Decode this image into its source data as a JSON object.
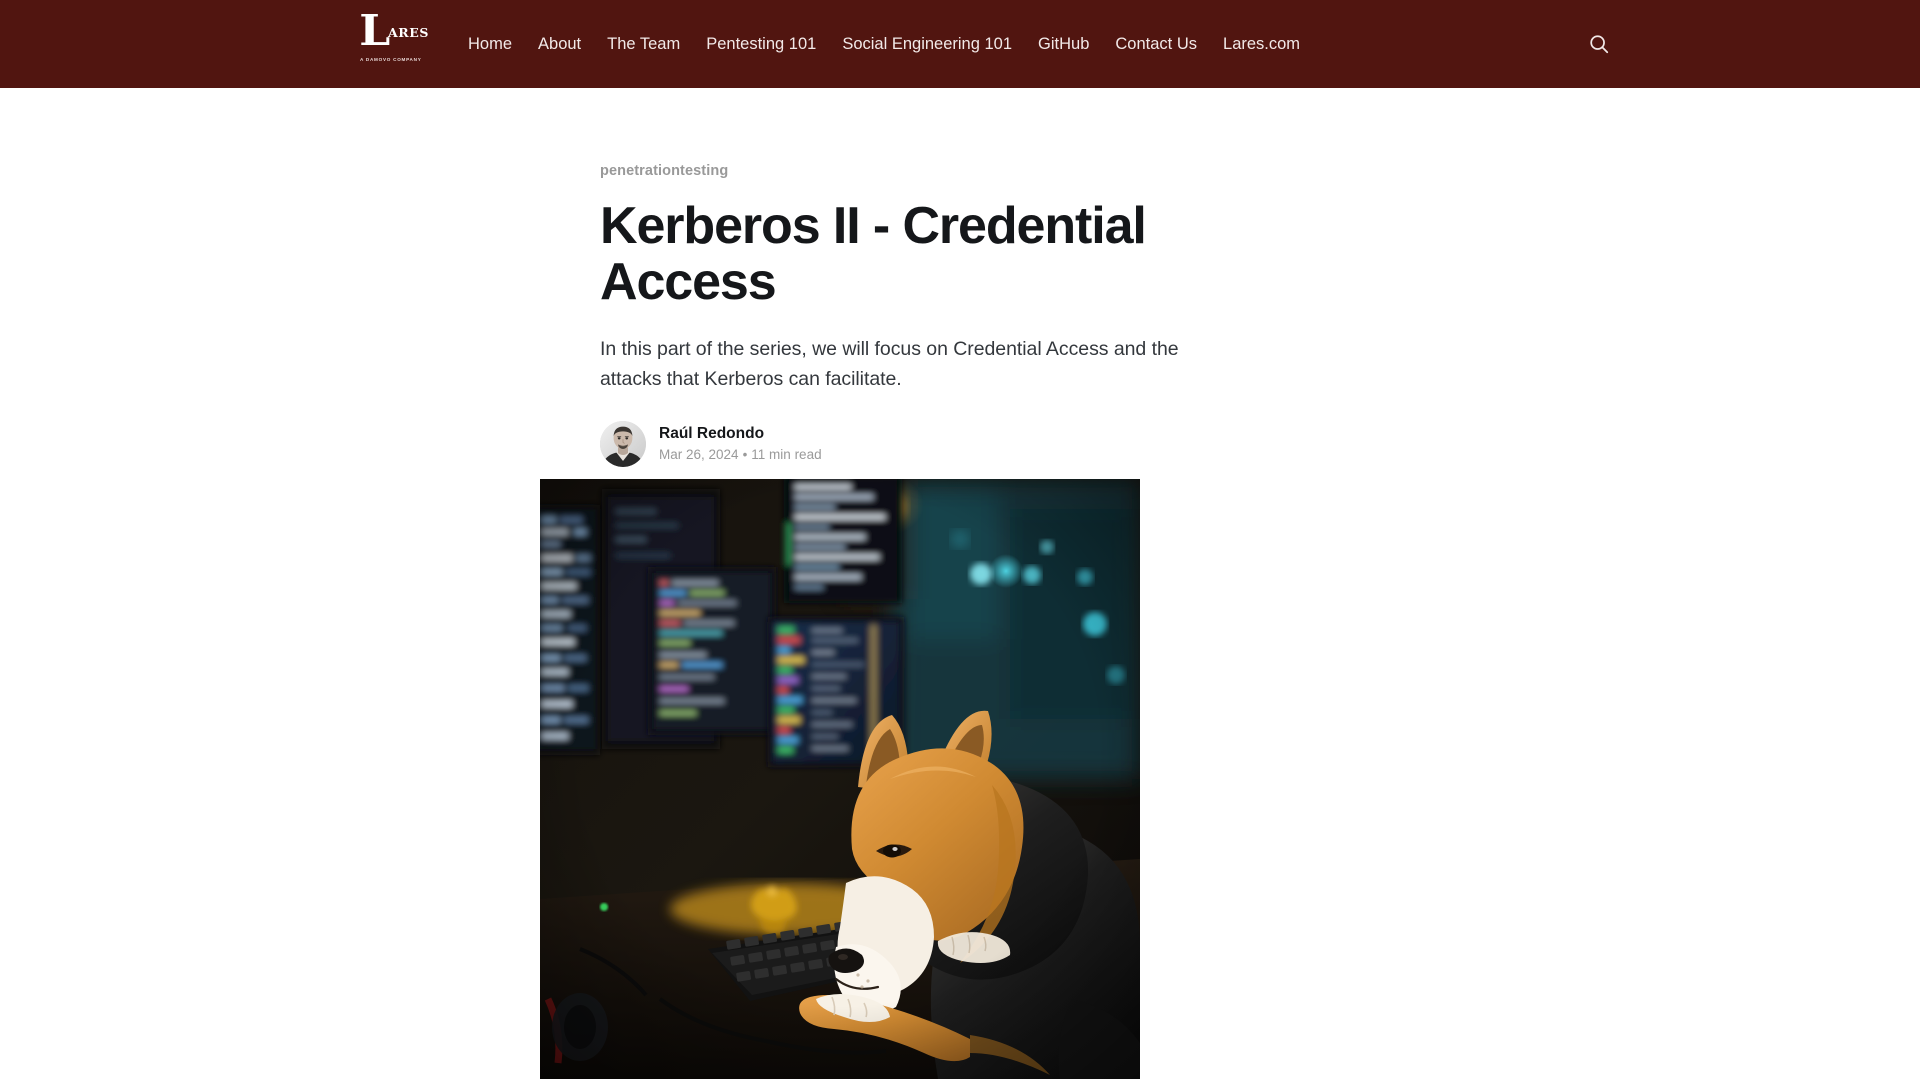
{
  "site": {
    "header_bg": "#511510",
    "logo": {
      "letter": "L",
      "rest": "ARES",
      "tagline": "A DAMOVO COMPANY",
      "alt": "lares logo"
    },
    "nav": [
      {
        "label": "Home"
      },
      {
        "label": "About"
      },
      {
        "label": "The Team"
      },
      {
        "label": "Pentesting 101"
      },
      {
        "label": "Social Engineering 101"
      },
      {
        "label": "GitHub"
      },
      {
        "label": "Contact Us"
      },
      {
        "label": "Lares.com"
      }
    ],
    "search": {
      "icon": "search-icon",
      "label": "Search this site"
    }
  },
  "post": {
    "tag": "penetrationtesting",
    "title": "Kerberos II - Credential Access",
    "excerpt": "In this part of the series, we will focus on Credential Access and the attacks that Kerberos can facilitate.",
    "author": {
      "name": "Raúl Redondo",
      "avatar_alt": "Raúl Redondo"
    },
    "date": "Mar 26, 2024",
    "separator": "•",
    "read_time": "11 min read",
    "feature_image_alt": "Shiba Inu dog wearing a black hoodie typing at a keyboard in front of multiple monitors"
  },
  "colors": {
    "brand": "#511510",
    "text": "#15171a",
    "muted": "#9a9a9a"
  }
}
